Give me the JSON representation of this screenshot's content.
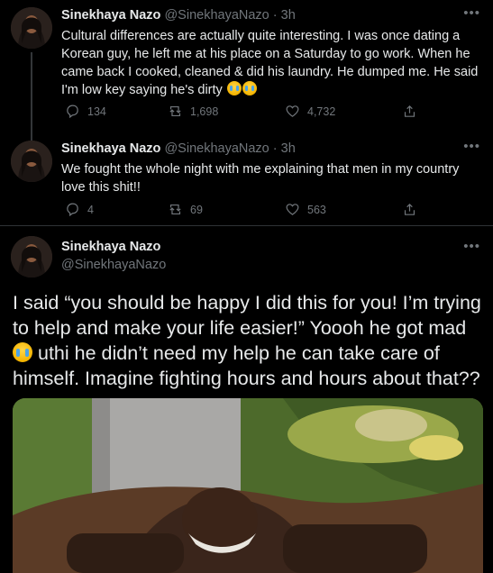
{
  "tweets": [
    {
      "name": "Sinekhaya Nazo",
      "handle": "@SinekhayaNazo",
      "dot": "·",
      "time": "3h",
      "more_icon": "more-horizontal-icon",
      "text": "Cultural differences are actually quite interesting. I was once dating a Korean guy, he left me at his place on a Saturday to go work. When he came back I cooked, cleaned & did his laundry. He dumped me. He said I'm low key saying he's dirty",
      "emoji": "loudly-crying-face",
      "replies": "134",
      "retweets": "1,698",
      "likes": "4,732"
    },
    {
      "name": "Sinekhaya Nazo",
      "handle": "@SinekhayaNazo",
      "dot": "·",
      "time": "3h",
      "more_icon": "more-horizontal-icon",
      "text": "We fought the whole night with me explaining that men in my country love this shit!!",
      "replies": "4",
      "retweets": "69",
      "likes": "563"
    },
    {
      "name": "Sinekhaya Nazo",
      "handle": "@SinekhayaNazo",
      "more_icon": "more-horizontal-icon",
      "text_line1": "I said “you should be happy I did this for you! I’m trying to help and make your life easier!” Yoooh he got mad",
      "text_line2": "uthi he didn’t need my help he can take care of himself. Imagine fighting hours and hours about that??",
      "emoji": "loudly-crying-face",
      "media_alt": "meme-image-man-in-grave"
    }
  ],
  "colors": {
    "background": "#000000",
    "text_primary": "#e7e9ea",
    "text_secondary": "#71767b",
    "divider": "#2f3336"
  }
}
